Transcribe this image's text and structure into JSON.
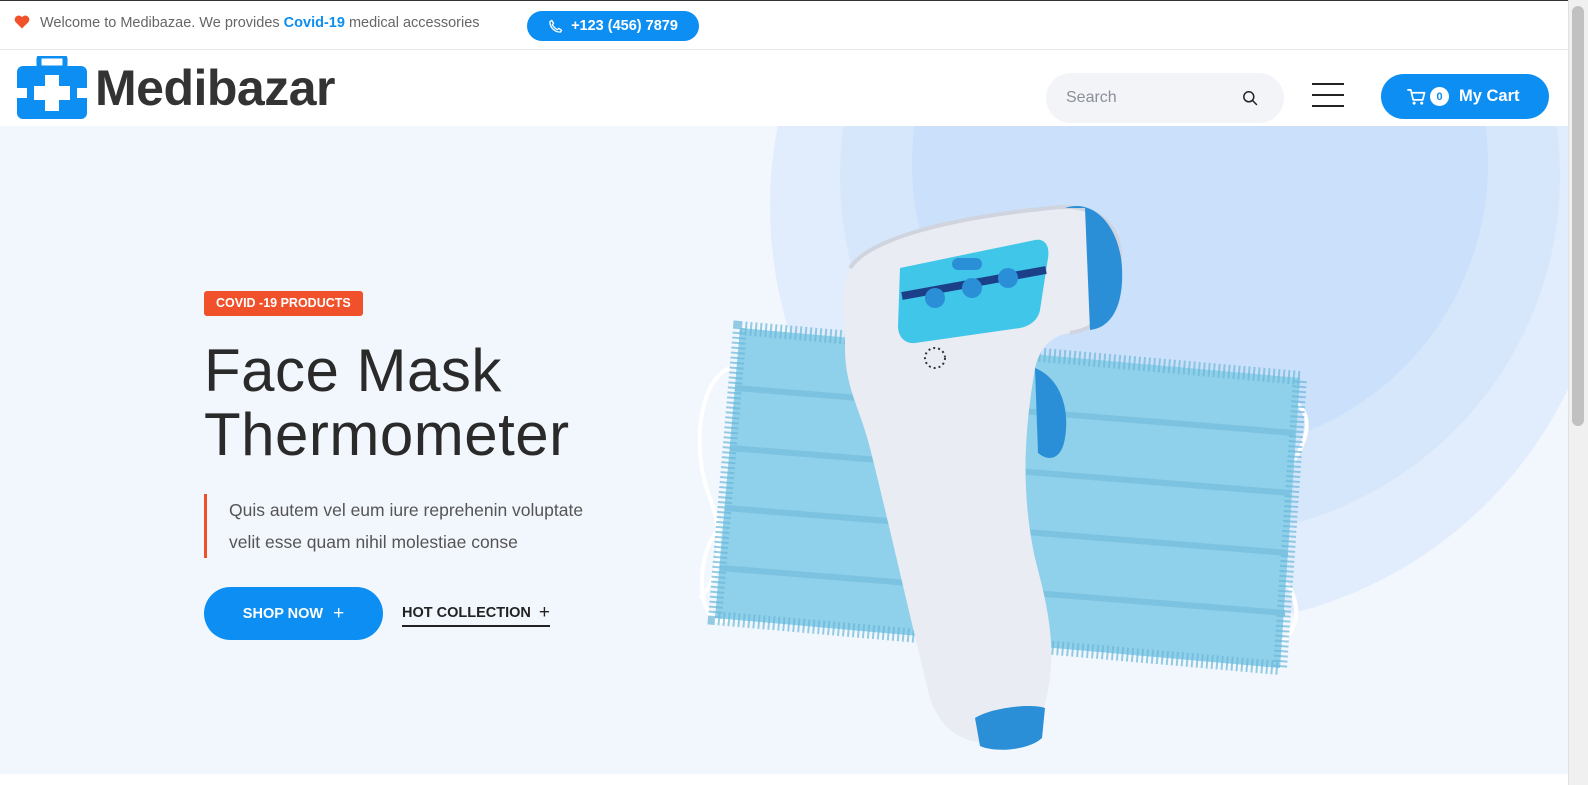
{
  "topbar": {
    "welcome_prefix": "Welcome to Medibazae. We provides",
    "welcome_highlight": "Covid-19",
    "welcome_suffix": "medical accessories",
    "phone": "+123 (456) 7879"
  },
  "header": {
    "logo_text": "Medibazar",
    "search_placeholder": "Search",
    "cart_count": "0",
    "cart_label": "My Cart"
  },
  "hero": {
    "tag": "COVID -19 PRODUCTS",
    "headline_line1": "Face Mask",
    "headline_line2": "Thermometer",
    "lead_line1": "Quis autem vel eum iure reprehenin voluptate",
    "lead_line2": "velit esse quam nihil molestiae conse",
    "shop_button": "SHOP NOW",
    "hot_collection": "HOT COLLECTION",
    "plus_symbol": "+"
  },
  "icons": {
    "heart": "heart-icon",
    "phone": "phone-icon",
    "search": "search-icon",
    "menu": "hamburger-menu-icon",
    "cart": "cart-icon",
    "logo": "medical-kit-icon"
  },
  "colors": {
    "primary": "#0d8ef2",
    "accent": "#f0502a",
    "hero_bg": "#f2f7fd",
    "text_dark": "#2a2a2a"
  }
}
